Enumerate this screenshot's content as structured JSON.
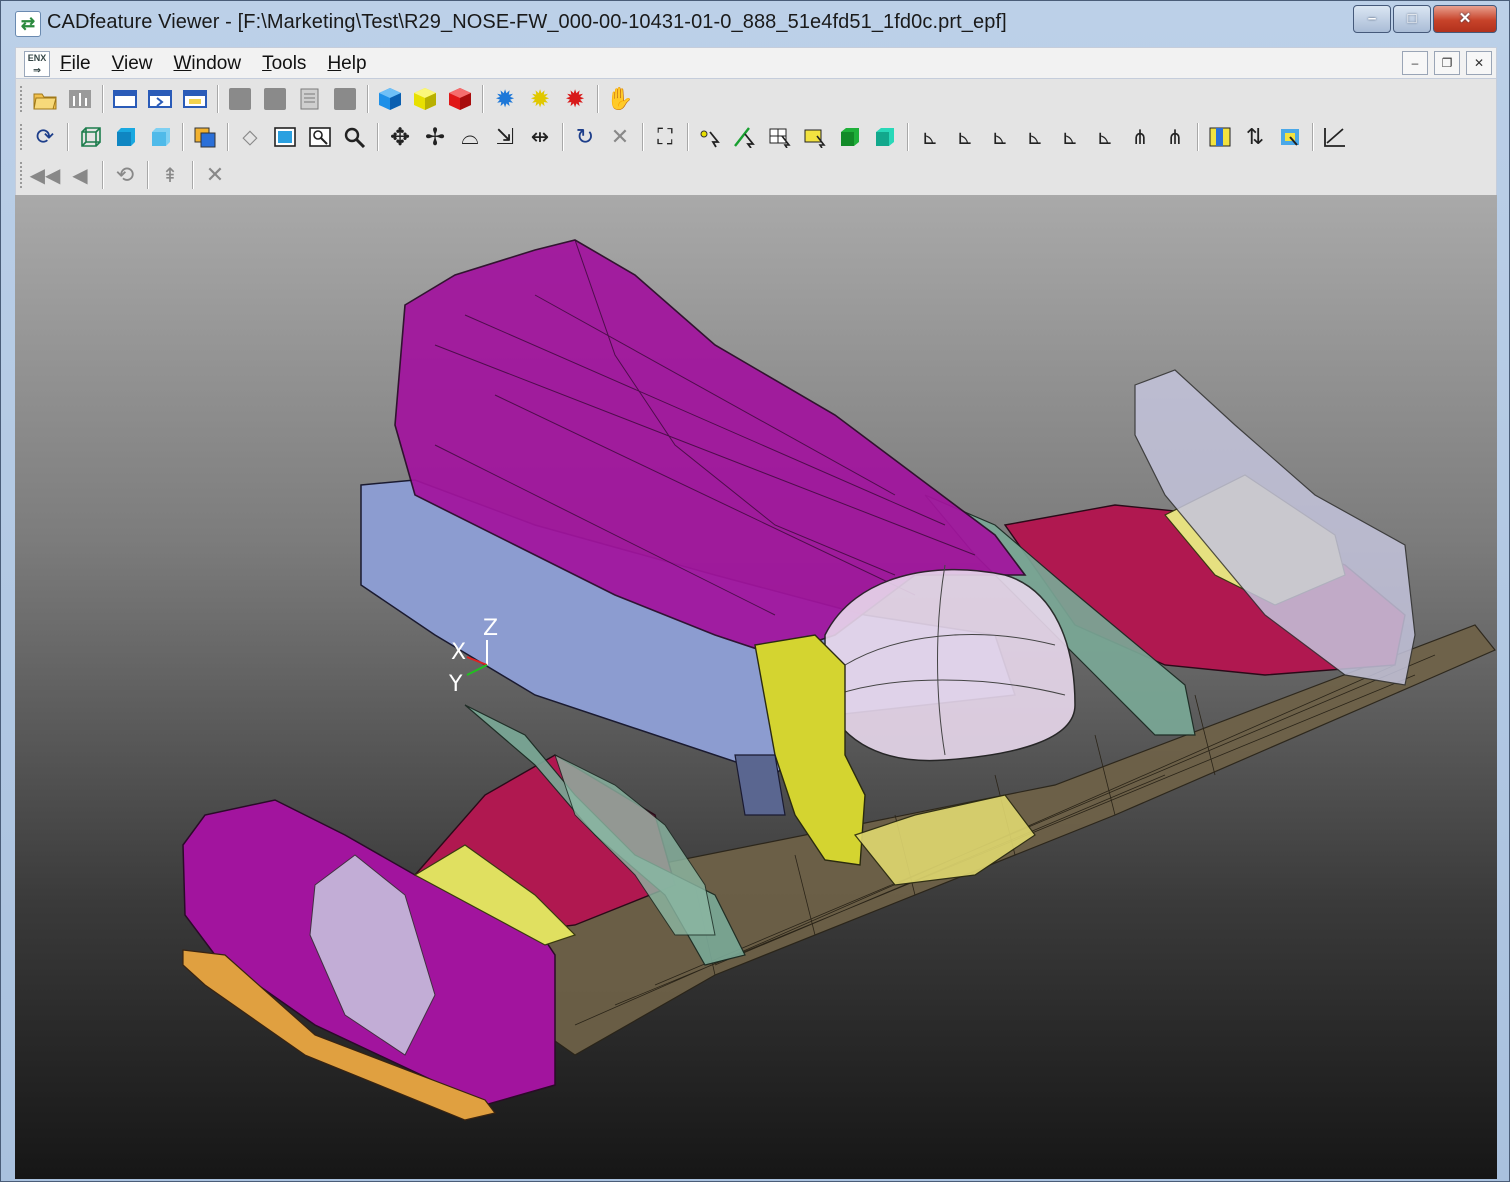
{
  "window": {
    "title": "CADfeature Viewer - [F:\\Marketing\\Test\\R29_NOSE-FW_000-00-10431-01-0_888_51e4fd51_1fd0c.prt_epf]",
    "app_icon": "arrows-cycle-icon",
    "controls": {
      "minimize": "–",
      "maximize": "□",
      "close": "✕"
    }
  },
  "menubar": {
    "logo_text": "ENX",
    "items": [
      {
        "underline": "F",
        "rest": "ile"
      },
      {
        "underline": "V",
        "rest": "iew"
      },
      {
        "underline": "W",
        "rest": "indow"
      },
      {
        "underline": "T",
        "rest": "ools"
      },
      {
        "underline": "H",
        "rest": "elp"
      }
    ],
    "mdi_controls": {
      "minimize": "–",
      "restore": "❐",
      "close": "✕"
    }
  },
  "toolbar": {
    "row1_icons": [
      "open-folder-icon",
      "grid-icon",
      "screen-icon",
      "next-screen-icon",
      "screen-alt-icon",
      "gray-square-icon",
      "gray-square-icon",
      "document-icon",
      "gray-square-icon",
      "blue-cube-icon",
      "yellow-cube-icon",
      "red-cube-icon",
      "blue-gear-icon",
      "yellow-gear-icon",
      "red-gear-icon",
      "hand-icon"
    ],
    "row2_icons": [
      "refresh-icon",
      "wireframe-box-icon",
      "shaded-box-icon",
      "transparent-box-icon",
      "layer-icon",
      "fit-icon",
      "zoom-window-icon",
      "zoom-area-icon",
      "magnifier-icon",
      "pan-icon",
      "move-icon",
      "rotate-icon",
      "translate-icon",
      "spin-icon",
      "undo-view-icon",
      "clear-icon",
      "select-icon",
      "pick-point-icon",
      "pick-edge-icon",
      "pick-face-icon",
      "pick-region-icon",
      "green-cube-icon",
      "cyan-cube-icon",
      "axis-x-icon",
      "axis-y-icon",
      "axis-z-icon",
      "axis-nx-icon",
      "axis-ny-icon",
      "axis-nz-icon",
      "iso-icon",
      "iso-alt-icon",
      "section-icon",
      "flip-icon",
      "palette-icon",
      "graph-icon"
    ],
    "row3_icons": [
      "rewind-icon",
      "back-icon",
      "reset-icon",
      "measure-icon",
      "cancel-icon"
    ]
  },
  "viewport": {
    "triad": {
      "x_label": "X",
      "y_label": "Y",
      "z_label": "Z"
    },
    "model_colors": {
      "magenta": "#a2149e",
      "lavender": "#8c9cd0",
      "yellow": "#e0e060",
      "crimson": "#b01850",
      "teal": "#7aa896",
      "orange": "#e0a040",
      "floor": "#6f6248"
    }
  }
}
